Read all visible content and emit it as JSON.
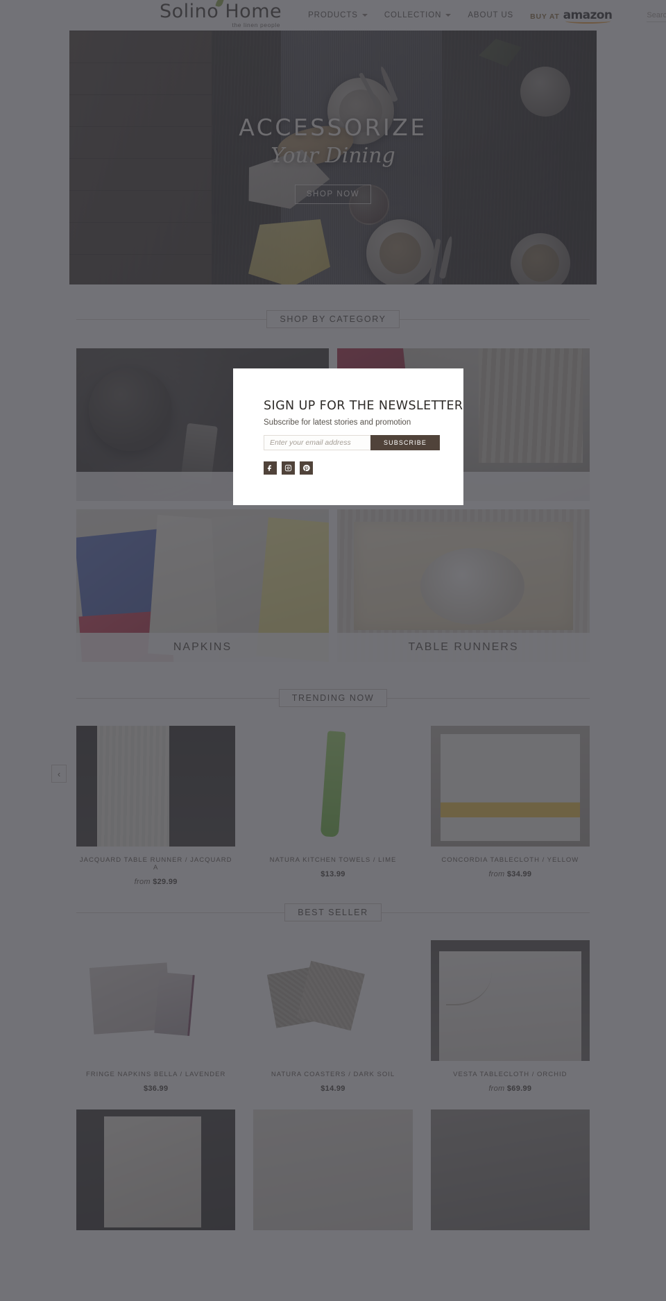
{
  "header": {
    "logo": {
      "name": "Solino Home",
      "tagline": "the linen people"
    },
    "nav": [
      {
        "label": "PRODUCTS",
        "has_caret": true
      },
      {
        "label": "COLLECTION",
        "has_caret": true
      },
      {
        "label": "ABOUT US",
        "has_caret": false
      }
    ],
    "amazon": {
      "pre": "BUY AT",
      "word": "amazon"
    },
    "search": {
      "placeholder": "Search",
      "value": ""
    }
  },
  "hero": {
    "title_line1": "ACCESSORIZE",
    "title_line2": "Your Dining",
    "cta": "SHOP NOW"
  },
  "sections": {
    "category_title": "SHOP BY CATEGORY",
    "trending_title": "TRENDING NOW",
    "bestseller_title": "BEST SELLER"
  },
  "categories": [
    {
      "label": "",
      "art": "img-dinner"
    },
    {
      "label": "",
      "art": "img-living"
    },
    {
      "label": "NAPKINS",
      "art": "img-napkins"
    },
    {
      "label": "TABLE RUNNERS",
      "art": "img-runner"
    }
  ],
  "trending": [
    {
      "name": "JACQUARD TABLE RUNNER / JACQUARD A",
      "from": "from",
      "price": "$29.99",
      "art": "pa-runner"
    },
    {
      "name": "NATURA KITCHEN TOWELS / LIME",
      "from": "",
      "price": "$13.99",
      "art": "pa-towel"
    },
    {
      "name": "CONCORDIA TABLECLOTH / YELLOW",
      "from": "from",
      "price": "$34.99",
      "art": "pa-cloth"
    }
  ],
  "bestseller": [
    {
      "name": "FRINGE NAPKINS BELLA / LAVENDER",
      "from": "",
      "price": "$36.99",
      "art": "pa-fringe"
    },
    {
      "name": "NATURA COASTERS / DARK SOIL",
      "from": "",
      "price": "$14.99",
      "art": "pa-coaster"
    },
    {
      "name": "VESTA TABLECLOTH / ORCHID",
      "from": "from",
      "price": "$69.99",
      "art": "pa-vesta"
    }
  ],
  "bottom_row": [
    {
      "art": "pa-b1"
    },
    {
      "art": "pa-b2"
    },
    {
      "art": "pa-b3"
    }
  ],
  "carousel": {
    "prev": "‹"
  },
  "modal": {
    "title": "SIGN UP FOR THE NEWSLETTER",
    "subtitle": "Subscribe for latest stories and promotion",
    "email_placeholder": "Enter your email address",
    "email_value": "",
    "subscribe_label": "SUBSCRIBE",
    "social": [
      {
        "name": "facebook",
        "glyph": "f"
      },
      {
        "name": "instagram",
        "glyph": "▣"
      },
      {
        "name": "pinterest",
        "glyph": "P"
      }
    ]
  },
  "colors": {
    "brand_brown": "#50433a",
    "accent_green": "#8fae4b",
    "amazon_orange": "#f0a33a",
    "text_dark": "#3d3935",
    "overlay": "rgba(60,60,66,0.72)"
  }
}
